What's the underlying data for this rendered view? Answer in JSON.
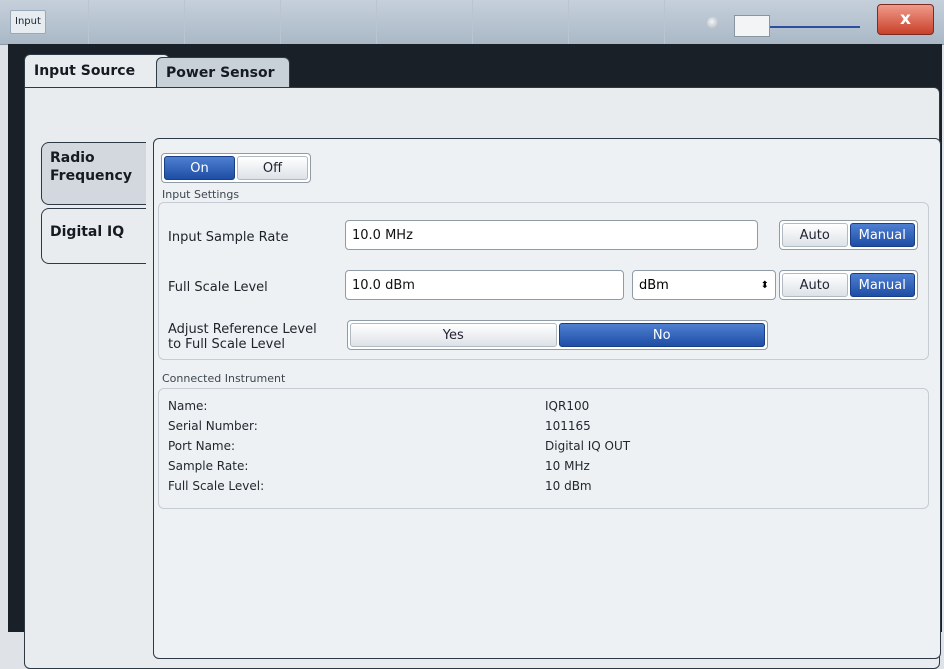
{
  "window": {
    "title": "Input",
    "close_glyph": "x"
  },
  "tabs": [
    {
      "label": "Input Source",
      "active": true
    },
    {
      "label": "Power Sensor",
      "active": false
    }
  ],
  "side_tabs": [
    {
      "label": "Radio Frequency",
      "active": false
    },
    {
      "label": "Digital IQ",
      "active": true
    }
  ],
  "state_toggle": {
    "on": "On",
    "off": "Off",
    "selected": "On"
  },
  "input_settings": {
    "heading": "Input Settings",
    "sample_rate": {
      "label": "Input Sample Rate",
      "value": "10.0 MHz",
      "auto": "Auto",
      "manual": "Manual",
      "selected": "Manual"
    },
    "full_scale": {
      "label": "Full Scale Level",
      "value": "10.0 dBm",
      "unit": "dBm",
      "auto": "Auto",
      "manual": "Manual",
      "selected": "Manual"
    },
    "adjust_ref": {
      "label_line1": "Adjust Reference Level",
      "label_line2": "to Full Scale Level",
      "yes": "Yes",
      "no": "No",
      "selected": "No"
    }
  },
  "connected_instrument": {
    "heading": "Connected Instrument",
    "rows": [
      {
        "label": "Name:",
        "value": "IQR100"
      },
      {
        "label": "Serial Number:",
        "value": "101165"
      },
      {
        "label": "Port Name:",
        "value": "Digital IQ OUT"
      },
      {
        "label": "Sample Rate:",
        "value": "10 MHz"
      },
      {
        "label": "Full Scale Level:",
        "value": "10 dBm"
      }
    ]
  },
  "colors": {
    "accent": "#1e4ea5",
    "close": "#c8412a",
    "frame": "#1a2027"
  }
}
